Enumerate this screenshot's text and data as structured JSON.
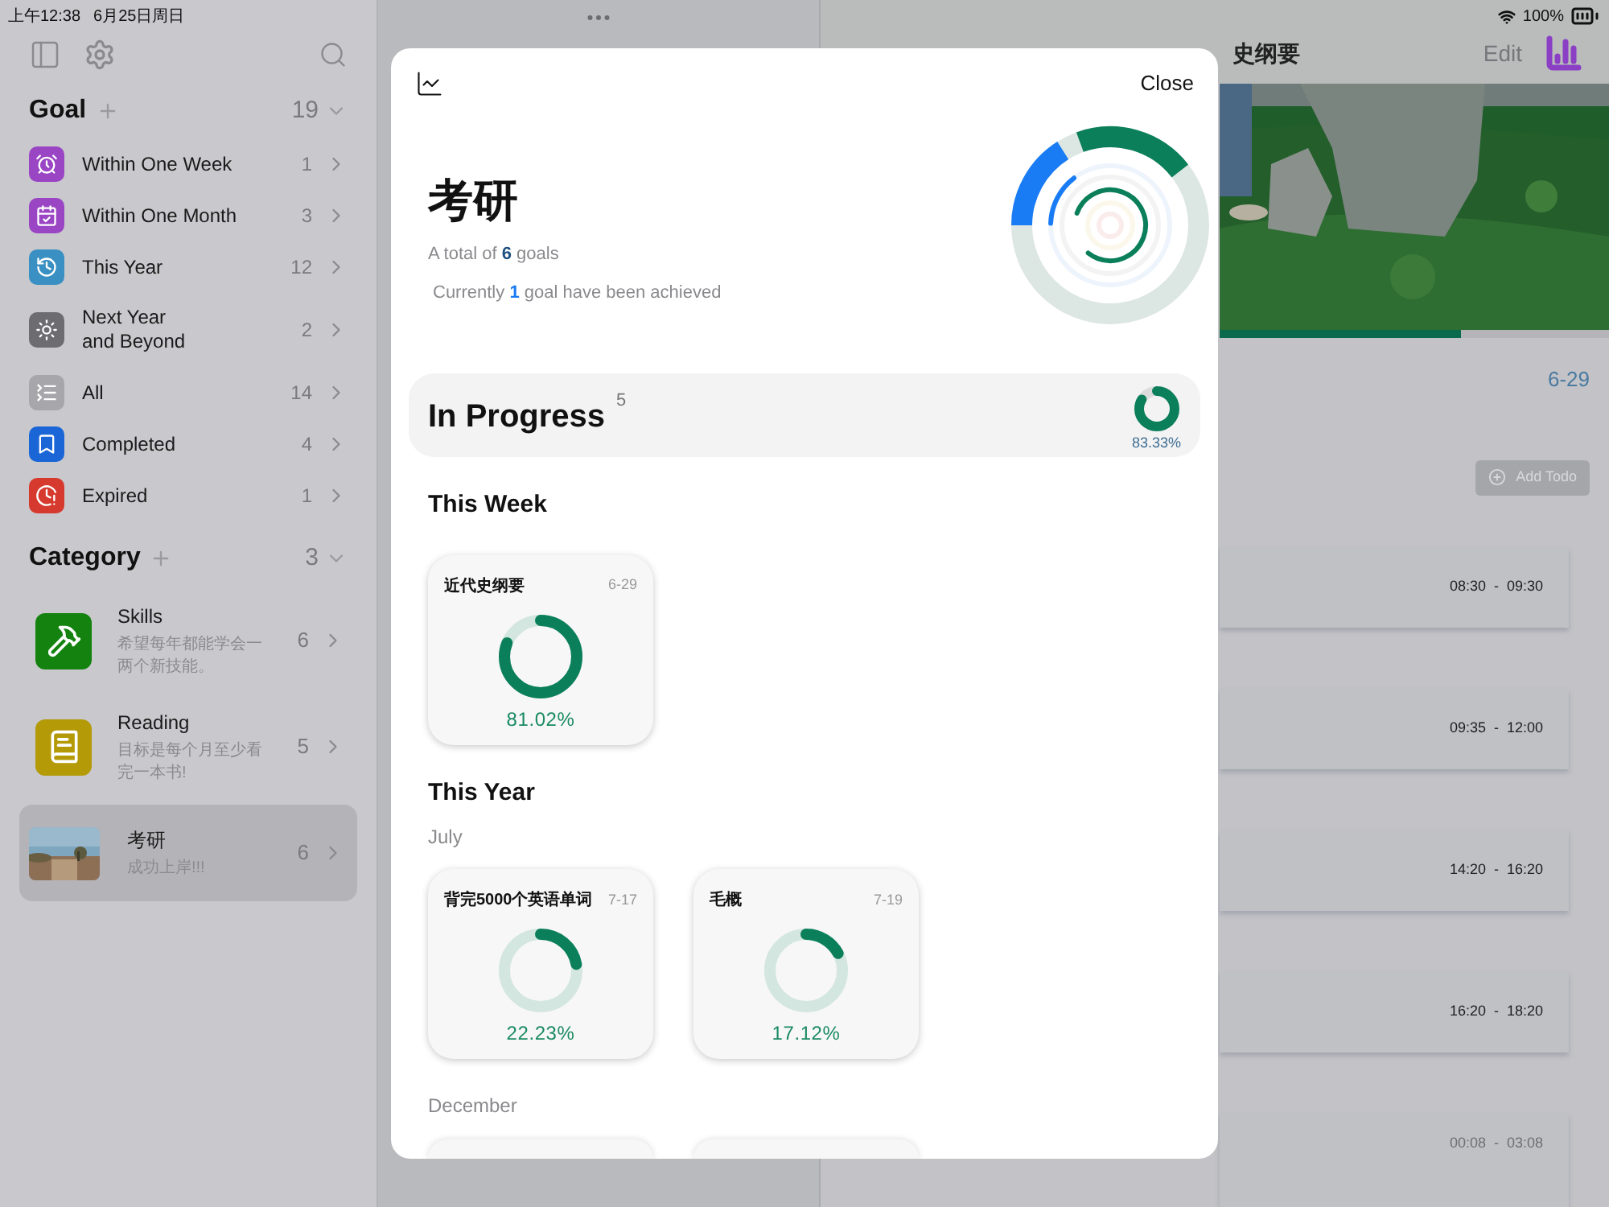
{
  "status_bar": {
    "time": "上午12:38",
    "date": "6月25日周日",
    "battery": "100%"
  },
  "sidebar": {
    "goal_section": {
      "title": "Goal",
      "count": "19",
      "items": [
        {
          "label": "Within One Week",
          "count": "1",
          "color": "#9a45c4"
        },
        {
          "label": "Within One Month",
          "count": "3",
          "color": "#9a45c4"
        },
        {
          "label": "This Year",
          "count": "12",
          "color": "#3a90c2"
        },
        {
          "label": "Next Year\nand Beyond",
          "count": "2",
          "color": "#6c6c71"
        },
        {
          "label": "All",
          "count": "14",
          "color": "#a6a6ab"
        },
        {
          "label": "Completed",
          "count": "4",
          "color": "#1a66d6"
        },
        {
          "label": "Expired",
          "count": "1",
          "color": "#d63a2f"
        }
      ]
    },
    "category_section": {
      "title": "Category",
      "count": "3",
      "items": [
        {
          "kind": "icon",
          "name": "Skills",
          "description": "希望每年都能学会一两个新技能。",
          "count": "6",
          "color": "#13820f",
          "selected": false
        },
        {
          "kind": "icon",
          "name": "Reading",
          "description": "目标是每个月至少看完一本书!",
          "count": "5",
          "color": "#b39a06",
          "selected": false
        },
        {
          "name": "考研",
          "description": "成功上岸!!!",
          "count": "6",
          "selected": true
        }
      ]
    }
  },
  "right_pane": {
    "title": "史纲要",
    "edit": "Edit",
    "progress": {
      "level": 0.62
    },
    "date": "6-29",
    "add_todo": "Add Todo",
    "todos": [
      {
        "time": "08:30  -  09:30",
        "dimmed": false
      },
      {
        "time": "09:35  -  12:00",
        "dimmed": false
      },
      {
        "time": "14:20  -  16:20",
        "dimmed": false
      },
      {
        "time": "16:20  -  18:20",
        "dimmed": false
      },
      {
        "time": "00:08  -  03:08",
        "dimmed": true
      }
    ]
  },
  "modal": {
    "close": "Close",
    "title": "考研",
    "summary": [
      "A total of **6** goals",
      "Currently **1** goal have been achieved"
    ],
    "in_progress": {
      "label": "In Progress",
      "count": "5",
      "level": 0.8333,
      "percent": "83.33%"
    },
    "sections": [
      {
        "title": "This Week",
        "groups": [
          {
            "cards": [
              {
                "kind": "goal",
                "title": "近代史纲要",
                "date": "6-29",
                "level": 0.8102,
                "percent": "81.02%"
              }
            ]
          }
        ]
      },
      {
        "title": "This Year",
        "groups": [
          {
            "month": "July",
            "cards": [
              {
                "kind": "goal",
                "title": "背完5000个英语单词",
                "date": "7-17",
                "level": 0.2223,
                "percent": "22.23%"
              },
              {
                "kind": "goal",
                "title": "毛概",
                "date": "7-19",
                "level": 0.1712,
                "percent": "17.12%"
              }
            ]
          },
          {
            "month": "December",
            "cards": [
              {
                "kind": "cut"
              },
              {
                "kind": "cut"
              }
            ]
          }
        ]
      }
    ]
  }
}
